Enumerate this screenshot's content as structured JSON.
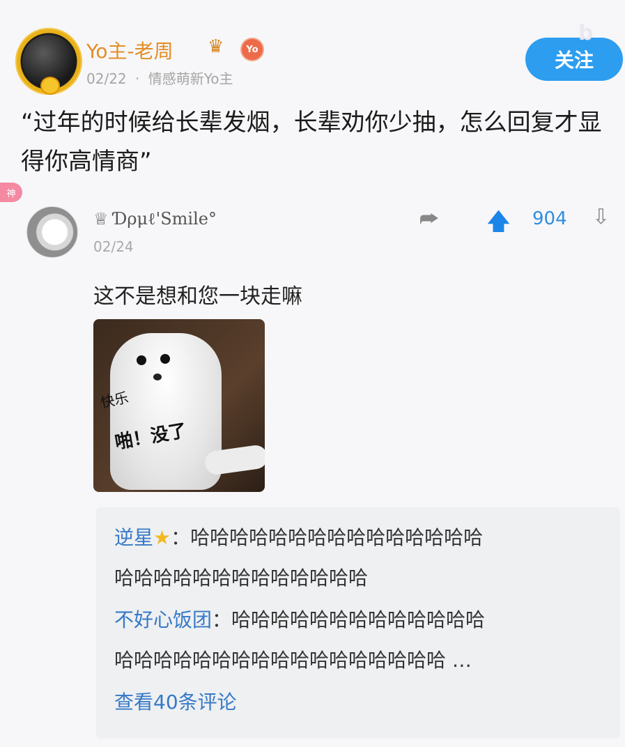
{
  "post": {
    "poster_name": "Yo主-老周",
    "crown_icon": "crown-icon",
    "yo_badge": "Yo",
    "date": "02/22",
    "meta_sep": "·",
    "category": "情感萌新Yo主",
    "follow_label": "关注",
    "text": "“过年的时候给长辈发烟，长辈劝你少抽，怎么回复才显得你高情商”"
  },
  "comment": {
    "god_badge": "神",
    "username": "♕ Ɗρμℓ'Smile°",
    "date": "02/24",
    "share_icon": "share-icon",
    "upvote_icon": "arrow-up-icon",
    "votes": "904",
    "downvote_icon": "arrow-down-icon",
    "text": "这不是想和您一块走嘛",
    "meme": {
      "caption_small": "快乐",
      "caption_big": "啪！没了"
    }
  },
  "replies": [
    {
      "name": "逆星",
      "icon": "star-icon",
      "sep": "：",
      "line1": "哈哈哈哈哈哈哈哈哈哈哈哈哈哈哈",
      "line2": "哈哈哈哈哈哈哈哈哈哈哈哈哈"
    },
    {
      "name": "不好心饭团",
      "sep": "：",
      "line1": "哈哈哈哈哈哈哈哈哈哈哈哈哈",
      "line2": "哈哈哈哈哈哈哈哈哈哈哈哈哈哈哈哈哈 …"
    }
  ],
  "more_label": "查看40条评论",
  "colors": {
    "accent_blue": "#2d9df0",
    "name_orange": "#e48d24",
    "reply_name_blue": "#3779c6"
  }
}
